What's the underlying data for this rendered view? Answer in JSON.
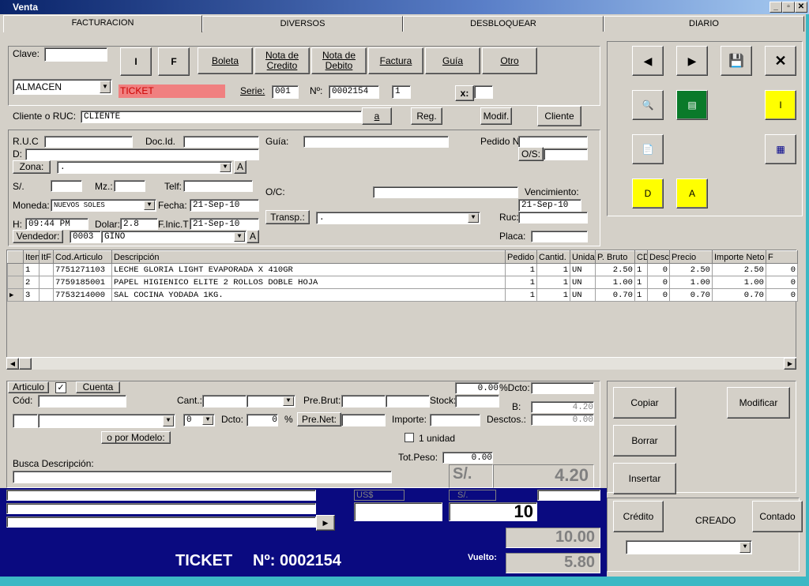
{
  "window": {
    "title": "Venta",
    "min": "_",
    "max": "▫",
    "close": "✕"
  },
  "tabs": [
    "FACTURACION",
    "DIVERSOS",
    "DESBLOQUEAR",
    "DIARIO"
  ],
  "doc": {
    "clave_label": "Clave:",
    "btn_i": "I",
    "btn_f": "F",
    "doc_types": [
      "Boleta",
      "Nota de\nCredito",
      "Nota de\nDebito",
      "Factura",
      "Guía",
      "Otro"
    ],
    "almacen": "ALMACEN",
    "ticket": "TICKET",
    "serie_label": "Serie:",
    "serie": "001",
    "nro_label": "Nº:",
    "nro": "0002154",
    "copies": "1",
    "x_label": "x:"
  },
  "cliente": {
    "label": "Cliente o RUC:",
    "value": "CLIENTE",
    "btn_a": "a",
    "btn_reg": "Reg.",
    "btn_modif": "Modif.",
    "btn_cliente": "Cliente"
  },
  "form": {
    "ruc": "R.U.C",
    "docid": "Doc.Id.",
    "guia": "Guía:",
    "pedido": "Pedido Nº:",
    "d": "D:",
    "zona": "Zona:",
    "zona_value": ".",
    "a": "A",
    "os": "O/S:",
    "soles": "S/.",
    "mz": "Mz.:",
    "telf": "Telf:",
    "oc": "O/C:",
    "vencimiento": "Vencimiento:",
    "venc_value": "21-Sep-10",
    "moneda": "Moneda:",
    "moneda_value": "NUEVOS SOLES",
    "fecha": "Fecha:",
    "fecha_value": "21-Sep-10",
    "h": "H:",
    "hora": "09:44 PM",
    "dolar": "Dolar:",
    "dolar_value": "2.8",
    "finic": "F.Inic.T",
    "finic_value": "21-Sep-10",
    "transp": "Transp.:",
    "transp_value": ".",
    "ruc2": "Ruc:",
    "placa": "Placa:",
    "vendedor": "Vendedor:",
    "vend_code": "0003",
    "vend_name": "GINO"
  },
  "grid": {
    "headers": [
      "Iten",
      "ItF",
      "Cod.Articulo",
      "Descripción",
      "Pedido",
      "Cantid.",
      "Unida",
      "P. Bruto",
      "CD",
      "Desc",
      "Precio",
      "Importe Neto",
      "F"
    ],
    "rows": [
      [
        "1",
        "",
        "7751271103",
        "LECHE GLORIA LIGHT EVAPORADA X 410GR",
        "1",
        "1",
        "UN",
        "2.50",
        "1",
        "0",
        "2.50",
        "2.50",
        "0"
      ],
      [
        "2",
        "",
        "7759185001",
        "PAPEL HIGIENICO ELITE 2 ROLLOS DOBLE HOJA",
        "1",
        "1",
        "UN",
        "1.00",
        "1",
        "0",
        "1.00",
        "1.00",
        "0"
      ],
      [
        "3",
        "",
        "7753214000",
        "SAL COCINA YODADA 1KG.",
        "1",
        "1",
        "UN",
        "0.70",
        "1",
        "0",
        "0.70",
        "0.70",
        "0"
      ]
    ]
  },
  "bottom": {
    "articulo": "Articulo",
    "cuenta": "Cuenta",
    "cod": "Cód:",
    "cant": "Cant.:",
    "prebrut": "Pre.Brut:",
    "stock": "Stock:",
    "dctopct": "%Dcto:",
    "val000": "0.00",
    "b": "B:",
    "b_val": "4.20",
    "dcto": "Dcto:",
    "dcto_sel": "0",
    "dcto_val": "0",
    "pct": "%",
    "prenet": "Pre.Net:",
    "importe": "Importe:",
    "desctos": "Desctos.:",
    "desctos_val": "0.00",
    "por_modelo": "o por Modelo:",
    "unidad": "1 unidad",
    "busca": "Busca Descripción:",
    "totpeso": "Tot.Peso:",
    "totpeso_val": "0.00",
    "soles": "S/.",
    "total": "4.20"
  },
  "actions": {
    "copiar": "Copiar",
    "modificar": "Modificar",
    "borrar": "Borrar",
    "insertar": "Insertar",
    "credito": "Crédito",
    "creado": "CREADO",
    "contado": "Contado"
  },
  "side": {
    "btn_i": "I",
    "btn_d": "D",
    "btn_a": "A",
    "colors": {
      "green": "#0a7a2a",
      "yellow": "#ffff00",
      "pink": "#f08080"
    }
  },
  "payment": {
    "usd": "US$",
    "sol": "S/.",
    "paid": "10",
    "received": "10.00",
    "vuelto": "Vuelto:",
    "vuelto_val": "5.80",
    "ticket": "TICKET",
    "nro": "Nº: 0002154"
  }
}
